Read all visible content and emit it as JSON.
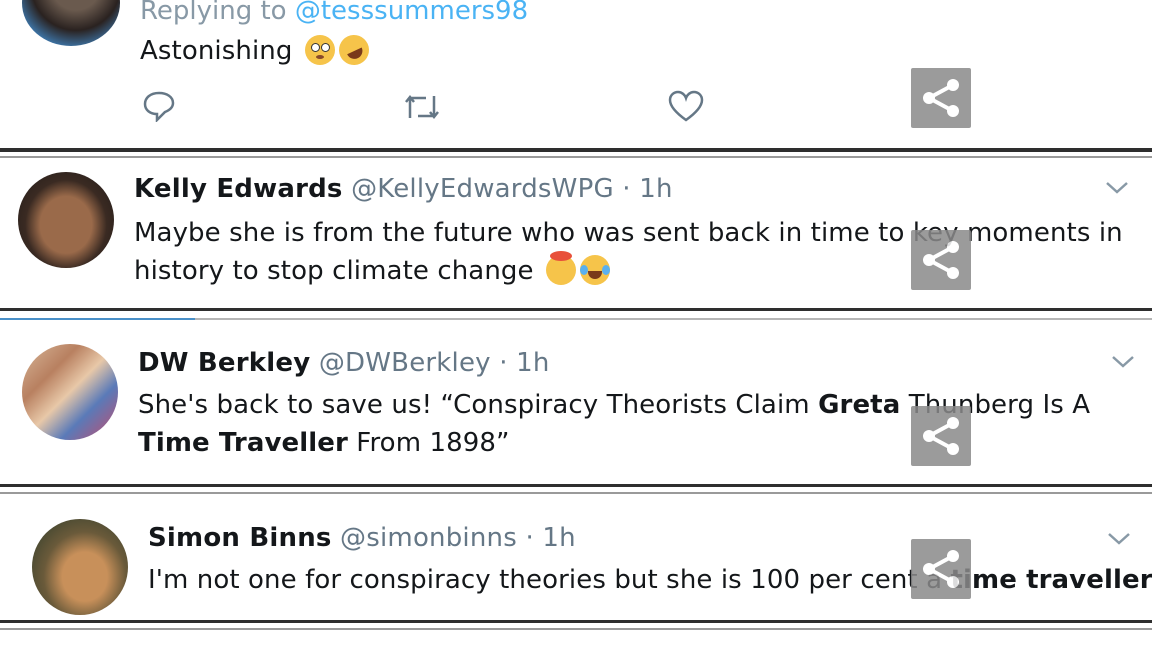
{
  "top_tweet": {
    "replying_prefix": "Replying to",
    "replying_handle": "@tesssummers98",
    "text": "Astonishing",
    "emojis": [
      "flushed-face-emoji",
      "rolling-laughing-emoji"
    ]
  },
  "tweets": [
    {
      "name": "Kelly Edwards",
      "handle": "@KellyEdwardsWPG",
      "dot": "·",
      "time": "1h",
      "line1": "Maybe she is from the future who was sent back in time to key moments in",
      "line2": "history to stop climate change",
      "emojis": [
        "exploding-head-emoji",
        "tears-of-joy-emoji"
      ]
    },
    {
      "name": "DW Berkley",
      "handle": "@DWBerkley",
      "dot": "·",
      "time": "1h",
      "line1_a": "She's back to save us!  “Conspiracy Theorists Claim ",
      "line1_b": "Greta",
      "line1_c": " Thunberg Is A",
      "line2_a": "Time Traveller",
      "line2_b": " From 1898”"
    },
    {
      "name": "Simon Binns",
      "handle": "@simonbinns",
      "dot": "·",
      "time": "1h",
      "line1_a": "I'm not one for conspiracy theories but she is 100 per cent a ",
      "line1_b": "time traveller",
      "line1_c": " -"
    }
  ],
  "colors": {
    "link": "#1da1f2",
    "secondary": "#657786",
    "share_overlay": "#8a8a8a"
  }
}
